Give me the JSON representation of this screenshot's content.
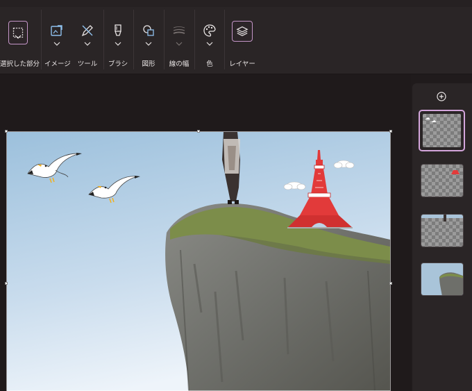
{
  "toolbar": {
    "selection_label": "選択した部分",
    "image_label": "イメージ",
    "tools_label": "ツール",
    "brush_label": "ブラシ",
    "shapes_label": "図形",
    "line_width_label": "線の幅",
    "color_label": "色",
    "layers_label": "レイヤー"
  },
  "icons": {
    "selection": "dashed-selection-icon",
    "image": "image-resize-icon",
    "tools": "pencil-tools-icon",
    "brush": "brush-icon",
    "shapes": "shapes-icon",
    "line_width": "line-width-icon",
    "color": "palette-icon",
    "layers": "layers-icon",
    "add_layer": "add-circle-icon"
  },
  "colors": {
    "accent": "#c596c9",
    "ribbon_bg": "#2a2526",
    "app_bg": "#201b1c"
  },
  "layers_panel": {
    "layers": [
      {
        "content": "birds",
        "selected": true
      },
      {
        "content": "tower",
        "selected": false
      },
      {
        "content": "person",
        "selected": false
      },
      {
        "content": "background-photo",
        "selected": false
      }
    ]
  }
}
